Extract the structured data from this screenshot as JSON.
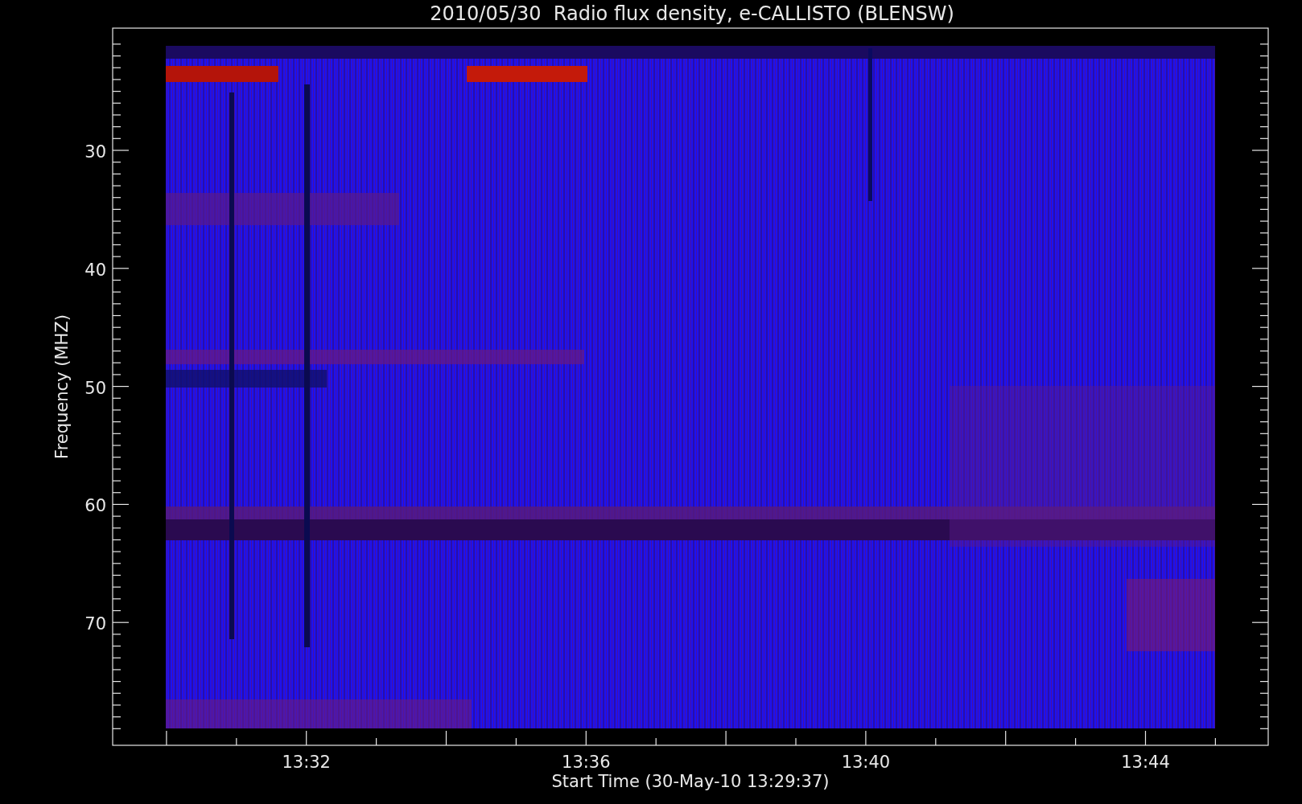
{
  "chart_title": "2010/05/30  Radio flux density, e-CALLISTO (BLENSW)",
  "y_axis": {
    "label": "Frequency (MHZ)",
    "ticks": [
      {
        "label": "30"
      },
      {
        "label": "40"
      },
      {
        "label": "50"
      },
      {
        "label": "60"
      },
      {
        "label": "70"
      }
    ]
  },
  "x_axis": {
    "label": "Start Time (30-May-10 13:29:37)",
    "ticks": [
      {
        "label": "13:32"
      },
      {
        "label": "13:36"
      },
      {
        "label": "13:40"
      },
      {
        "label": "13:44"
      }
    ]
  }
}
